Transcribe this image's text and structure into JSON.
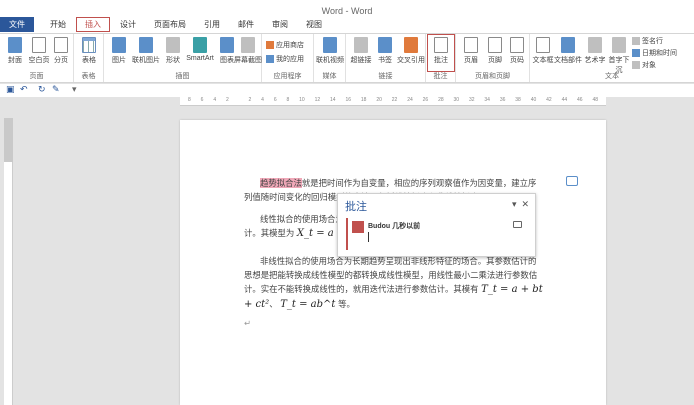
{
  "window": {
    "title": "Word - Word"
  },
  "tabs": [
    "文件",
    "开始",
    "插入",
    "设计",
    "页面布局",
    "引用",
    "邮件",
    "审阅",
    "视图"
  ],
  "ribbon": {
    "groups": {
      "pages": {
        "label": "页面",
        "buttons": [
          "封面",
          "空白页",
          "分页"
        ]
      },
      "tables": {
        "label": "表格",
        "buttons": [
          "表格"
        ]
      },
      "illustrations": {
        "label": "插图",
        "buttons": [
          "图片",
          "联机图片",
          "形状",
          "SmartArt",
          "图表",
          "屏幕截图"
        ]
      },
      "apps": {
        "label": "应用程序",
        "buttons": [
          "应用商店",
          "我的应用"
        ]
      },
      "media": {
        "label": "媒体",
        "buttons": [
          "联机视频"
        ]
      },
      "links": {
        "label": "链接",
        "buttons": [
          "超链接",
          "书签",
          "交叉引用"
        ]
      },
      "comments": {
        "label": "批注",
        "buttons": [
          "批注"
        ]
      },
      "header_footer": {
        "label": "页眉和页脚",
        "buttons": [
          "页眉",
          "页脚",
          "页码"
        ]
      },
      "text": {
        "label": "文本",
        "buttons": [
          "文本框",
          "文档部件",
          "艺术字",
          "首字下沉"
        ],
        "small": [
          "签名行",
          "日期和时间",
          "对象"
        ]
      }
    }
  },
  "ruler": {
    "numbers": [
      "8",
      "6",
      "4",
      "2",
      "",
      "2",
      "4",
      "6",
      "8",
      "10",
      "12",
      "14",
      "16",
      "18",
      "20",
      "22",
      "24",
      "26",
      "28",
      "30",
      "32",
      "34",
      "36",
      "38",
      "40",
      "42",
      "44",
      "46",
      "48"
    ]
  },
  "document": {
    "p1_highlight": "趋势拟合法",
    "p1_rest": "就是把时间作为自变量，相应的序列观察值作为因变量，建立序列值随时间变化的回归模型的方法。包括线性拟合和非线性拟合。",
    "p2_a": "线性拟合的使用场合为",
    "p2_b": "计。其模型为",
    "p2_math": "X_t = a + bt +",
    "p3": "非线性拟合的使用场合为长期趋势呈现出非线形特征的场合。其参数估计的思想是把能转换成线性模型的都转换成线性模型，用线性最小二乘法进行参数估计。实在不能转换成线性的，就用迭代法进行参数估计。其模有",
    "p3_math1": "T_t = a + bt + ct²",
    "p3_sep": "、",
    "p3_math2": "T_t = ab^t",
    "p3_end": "等。"
  },
  "comment_pane": {
    "title": "批注",
    "author": "Budou  几秒以前"
  }
}
